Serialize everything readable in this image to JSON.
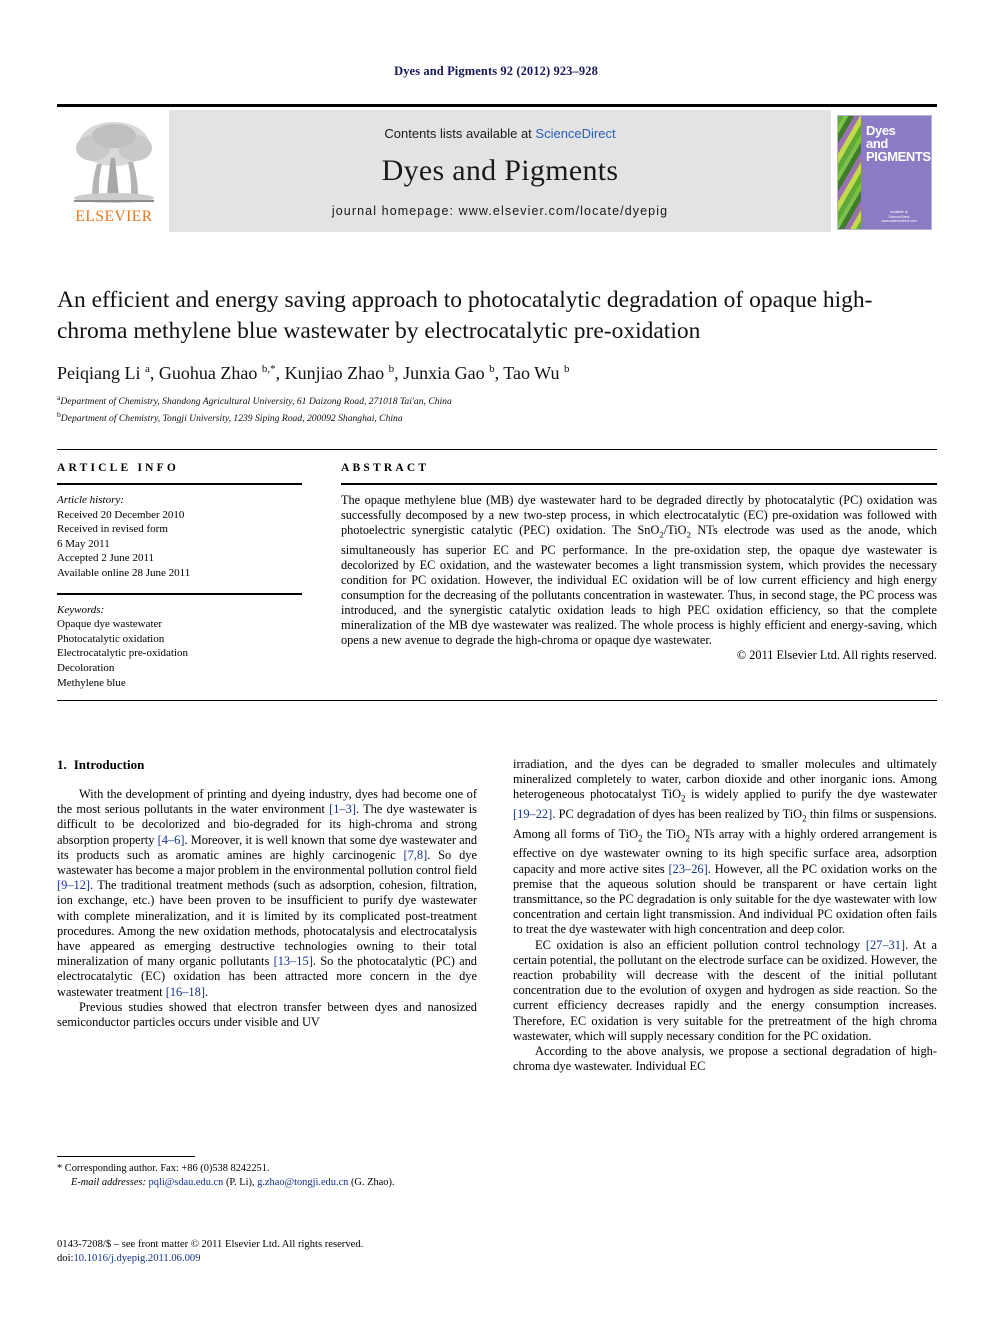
{
  "running_head": "Dyes and Pigments 92 (2012) 923–928",
  "masthead": {
    "contents_prefix": "Contents lists available at ",
    "sciencedirect": "ScienceDirect",
    "journal_name": "Dyes and Pigments",
    "homepage": "journal homepage: www.elsevier.com/locate/dyepig",
    "publisher_logo_text": "ELSEVIER",
    "cover_title_line1": "Dyes",
    "cover_title_line2": "and",
    "cover_title_line3": "PIGMENTS",
    "cover_sciencedirect": "available at",
    "cover_sciencedirect2": "ScienceDirect",
    "cover_sciencedirect3": "www.sciencedirect.com"
  },
  "article": {
    "title": "An efficient and energy saving approach to photocatalytic degradation of opaque high-chroma methylene blue wastewater by electrocatalytic pre-oxidation",
    "authors_html": "Peiqiang Li <sup>a</sup>, Guohua Zhao <sup>b,</sup><sup>*</sup>, Kunjiao Zhao <sup>b</sup>, Junxia Gao <sup>b</sup>, Tao Wu <sup>b</sup>",
    "affiliation_a": "Department of Chemistry, Shandong Agricultural University, 61 Daizong Road, 271018 Tai'an, China",
    "affiliation_b": "Department of Chemistry, Tongji University, 1239 Siping Road, 200092 Shanghai, China",
    "affil_a_marker": "a",
    "affil_b_marker": "b"
  },
  "article_info": {
    "heading": "ARTICLE INFO",
    "history_title": "Article history:",
    "history": [
      "Received 20 December 2010",
      "Received in revised form",
      "6 May 2011",
      "Accepted 2 June 2011",
      "Available online 28 June 2011"
    ],
    "keywords_title": "Keywords:",
    "keywords": [
      "Opaque dye wastewater",
      "Photocatalytic oxidation",
      "Electrocatalytic pre-oxidation",
      "Decoloration",
      "Methylene blue"
    ]
  },
  "abstract": {
    "heading": "ABSTRACT",
    "text_html": "The opaque methylene blue (MB) dye wastewater hard to be degraded directly by photocatalytic (PC) oxidation was successfully decomposed by a new two-step process, in which electrocatalytic (EC) pre-oxidation was followed with photoelectric synergistic catalytic (PEC) oxidation. The SnO<sub>2</sub>/TiO<sub>2</sub> NTs electrode was used as the anode, which simultaneously has superior EC and PC performance. In the pre-oxidation step, the opaque dye wastewater is decolorized by EC oxidation, and the wastewater becomes a light transmission system, which provides the necessary condition for PC oxidation. However, the individual EC oxidation will be of low current efficiency and high energy consumption for the decreasing of the pollutants concentration in wastewater. Thus, in second stage, the PC process was introduced, and the synergistic catalytic oxidation leads to high PEC oxidation efficiency, so that the complete mineralization of the MB dye wastewater was realized. The whole process is highly efficient and energy-saving, which opens a new avenue to degrade the high-chroma or opaque dye wastewater.",
    "copyright": "© 2011 Elsevier Ltd. All rights reserved."
  },
  "sections": {
    "intro_number": "1.",
    "intro_title": "Introduction",
    "left_paragraph_1_html": "With the development of printing and dyeing industry, dyes had become one of the most serious pollutants in the water environment <span class=\"ref\">[1–3]</span>. The dye wastewater is difficult to be decolorized and bio-degraded for its high-chroma and strong absorption property <span class=\"ref\">[4–6]</span>. Moreover, it is well known that some dye wastewater and its products such as aromatic amines are highly carcinogenic <span class=\"ref\">[7,8]</span>. So dye wastewater has become a major problem in the environmental pollution control field <span class=\"ref\">[9–12]</span>. The traditional treatment methods (such as adsorption, cohesion, filtration, ion exchange, etc.) have been proven to be insufficient to purify dye wastewater with complete mineralization, and it is limited by its complicated post-treatment procedures. Among the new oxidation methods, photocatalysis and electrocatalysis have appeared as emerging destructive technologies owning to their total mineralization of many organic pollutants <span class=\"ref\">[13–15]</span>. So the photocatalytic (PC) and electrocatalytic (EC) oxidation has been attracted more concern in the dye wastewater treatment <span class=\"ref\">[16–18]</span>.",
    "left_paragraph_2_html": "Previous studies showed that electron transfer between dyes and nanosized semiconductor particles occurs under visible and UV",
    "right_paragraph_1_html": "irradiation, and the dyes can be degraded to smaller molecules and ultimately mineralized completely to water, carbon dioxide and other inorganic ions. Among heterogeneous photocatalyst TiO<sub>2</sub> is widely applied to purify the dye wastewater <span class=\"ref\">[19–22]</span>. PC degradation of dyes has been realized by TiO<sub>2</sub> thin films or suspensions. Among all forms of TiO<sub>2</sub> the TiO<sub>2</sub> NTs array with a highly ordered arrangement is effective on dye wastewater owning to its high specific surface area, adsorption capacity and more active sites <span class=\"ref\">[23–26]</span>. However, all the PC oxidation works on the premise that the aqueous solution should be transparent or have certain light transmittance, so the PC degradation is only suitable for the dye wastewater with low concentration and certain light transmission. And individual PC oxidation often fails to treat the dye wastewater with high concentration and deep color.",
    "right_paragraph_2_html": "EC oxidation is also an efficient pollution control technology <span class=\"ref\">[27–31]</span>. At a certain potential, the pollutant on the electrode surface can be oxidized. However, the reaction probability will decrease with the descent of the initial pollutant concentration due to the evolution of oxygen and hydrogen as side reaction. So the current efficiency decreases rapidly and the energy consumption increases. Therefore, EC oxidation is very suitable for the pretreatment of the high chroma wastewater, which will supply necessary condition for the PC oxidation.",
    "right_paragraph_3_html": "According to the above analysis, we propose a sectional degradation of high-chroma dye wastewater. Individual EC"
  },
  "footnotes": {
    "corresponding_html": "* Corresponding author. Fax: +86 (0)538 8242251.",
    "email_html": "<span class=\"ital\">E-mail addresses:</span> <span class=\"mail\">pqli@sdau.edu.cn</span> (P. Li), <span class=\"mail\">g.zhao@tongji.edu.cn</span> (G. Zhao)."
  },
  "colophon": {
    "line1": "0143-7208/$ – see front matter © 2011 Elsevier Ltd. All rights reserved.",
    "doi_label": "doi:",
    "doi_value": "10.1016/j.dyepig.2011.06.009"
  }
}
